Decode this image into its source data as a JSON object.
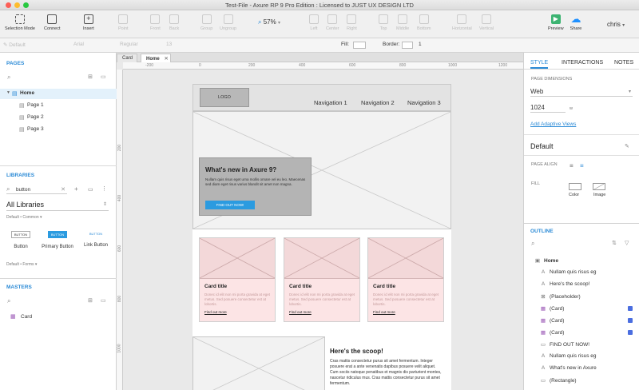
{
  "window": {
    "title": "Test-File - Axure RP 9 Pro Edition : Licensed to JUST UX DESIGN LTD"
  },
  "toolbar": {
    "selection_mode": "Selection Mode",
    "connect": "Connect",
    "insert": "Insert",
    "point": "Point",
    "front": "Front",
    "back": "Back",
    "group": "Group",
    "ungroup": "Ungroup",
    "zoom": "57%",
    "left": "Left",
    "center": "Center",
    "right": "Right",
    "top": "Top",
    "middle": "Middle",
    "bottom": "Bottom",
    "horizontal": "Horizontal",
    "vertical": "Vertical",
    "preview": "Preview",
    "share": "Share",
    "user": "chris"
  },
  "formatbar": {
    "style": "Default",
    "font": "Arial",
    "weight": "Regular",
    "size": "13",
    "fill_label": "Fill:",
    "border_label": "Border:",
    "border_value": "1"
  },
  "pages": {
    "header": "PAGES",
    "items": [
      "Home",
      "Page 1",
      "Page 2",
      "Page 3"
    ]
  },
  "libraries": {
    "header": "LIBRARIES",
    "search": "button",
    "selected": "All Libraries",
    "group_common": "Default • Common ▾",
    "widgets": [
      {
        "preview": "BUTTON",
        "label": "Button"
      },
      {
        "preview": "BUTTON",
        "label": "Primary Button"
      },
      {
        "preview": "BUTTON",
        "label": "Link Button"
      }
    ],
    "group_forms": "Default • Forms ▾"
  },
  "masters": {
    "header": "MASTERS",
    "items": [
      "Card"
    ]
  },
  "tabs": [
    {
      "label": "Card"
    },
    {
      "label": "Home"
    }
  ],
  "ruler": {
    "h": [
      "-200",
      "0",
      "200",
      "400",
      "600",
      "800",
      "1000",
      "1200"
    ],
    "v": [
      "200",
      "400",
      "600",
      "800",
      "1000"
    ]
  },
  "design": {
    "logo": "LOGO",
    "nav": [
      "Navigation 1",
      "Navigation 2",
      "Navigation 3"
    ],
    "hero_title": "What's new in Axure 9?",
    "hero_text": "Nullam quis risus eget urna mollis ornare vel eu leo. Maecenas sed diam eget risus varius blandit sit amet non magna.",
    "hero_button": "FIND OUT NOW!",
    "cards": [
      {
        "title": "Card title",
        "body": "Donec id elit non mi porta gravida at eget metus. Sed posuere consectetur est at lobortis.",
        "link": "Find out more"
      },
      {
        "title": "Card title",
        "body": "Donec id elit non mi porta gravida at eget metus. Sed posuere consectetur est at lobortis.",
        "link": "Find out more"
      },
      {
        "title": "Card title",
        "body": "Donec id elit non mi porta gravida at eget metus. Sed posuere consectetur est at lobortis.",
        "link": "Find out more"
      }
    ],
    "scoop_title": "Here's the scoop!",
    "scoop_text": "Cras mattis consectetur purus sit amet fermentum. Integer posuere erat a ante venenatis dapibus posuere velit aliquet. Cum sociis natoque penatibus et magnis dis parturient montes, nascetur ridiculus mus. Cras mattis consectetur purus sit amet fermentum."
  },
  "right_panel": {
    "tabs": [
      "STYLE",
      "INTERACTIONS",
      "NOTES"
    ],
    "page_dimensions_label": "PAGE DIMENSIONS",
    "dimension_preset": "Web",
    "width_value": "1024",
    "width_unit": "w",
    "adaptive_link": "Add Adaptive Views",
    "style_name": "Default",
    "page_align_label": "PAGE ALIGN",
    "fill_label": "FILL",
    "fill_color": "Color",
    "fill_image": "Image",
    "outline_header": "OUTLINE",
    "outline": [
      {
        "label": "Home",
        "icon": "page-icon",
        "glyph": "▣",
        "checked": false
      },
      {
        "label": "Nullam quis risus eg",
        "icon": "text-icon",
        "glyph": "A",
        "checked": false
      },
      {
        "label": "Here's the scoop!",
        "icon": "text-icon",
        "glyph": "A",
        "checked": false
      },
      {
        "label": "(Placeholder)",
        "icon": "placeholder-icon",
        "glyph": "⊠",
        "checked": false
      },
      {
        "label": "(Card)",
        "icon": "master-icon",
        "glyph": "▦",
        "checked": true
      },
      {
        "label": "(Card)",
        "icon": "master-icon",
        "glyph": "▦",
        "checked": true
      },
      {
        "label": "(Card)",
        "icon": "master-icon",
        "glyph": "▦",
        "checked": true
      },
      {
        "label": "FIND OUT NOW!",
        "icon": "button-icon",
        "glyph": "▭",
        "checked": false
      },
      {
        "label": "Nullam quis risus eg",
        "icon": "text-icon",
        "glyph": "A",
        "checked": false
      },
      {
        "label": "What's new in Axure",
        "icon": "text-icon",
        "glyph": "A",
        "checked": false
      },
      {
        "label": "(Rectangle)",
        "icon": "rectangle-icon",
        "glyph": "▭",
        "checked": false
      }
    ]
  },
  "colors": {
    "accent": "#2a8ad6",
    "hero_button": "#2b9be0",
    "card_bg": "#fce4e5",
    "preview_green": "#3cb371",
    "share_blue": "#1e90ff"
  }
}
